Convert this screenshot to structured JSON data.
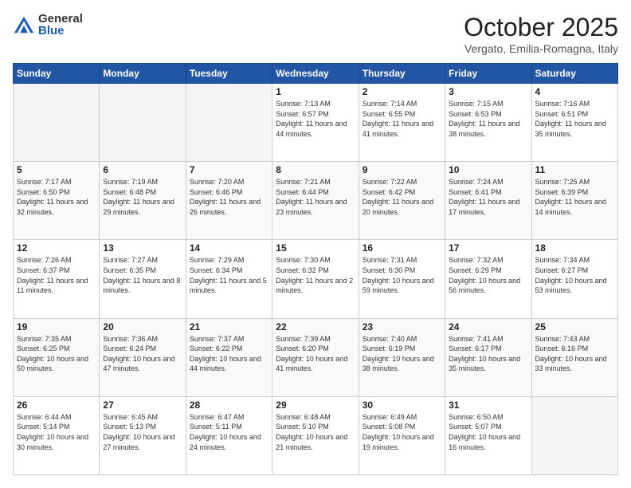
{
  "header": {
    "logo_general": "General",
    "logo_blue": "Blue",
    "month_title": "October 2025",
    "location": "Vergato, Emilia-Romagna, Italy"
  },
  "days_of_week": [
    "Sunday",
    "Monday",
    "Tuesday",
    "Wednesday",
    "Thursday",
    "Friday",
    "Saturday"
  ],
  "weeks": [
    [
      {
        "day": "",
        "info": ""
      },
      {
        "day": "",
        "info": ""
      },
      {
        "day": "",
        "info": ""
      },
      {
        "day": "1",
        "info": "Sunrise: 7:13 AM\nSunset: 6:57 PM\nDaylight: 11 hours and 44 minutes."
      },
      {
        "day": "2",
        "info": "Sunrise: 7:14 AM\nSunset: 6:55 PM\nDaylight: 11 hours and 41 minutes."
      },
      {
        "day": "3",
        "info": "Sunrise: 7:15 AM\nSunset: 6:53 PM\nDaylight: 11 hours and 38 minutes."
      },
      {
        "day": "4",
        "info": "Sunrise: 7:16 AM\nSunset: 6:51 PM\nDaylight: 11 hours and 35 minutes."
      }
    ],
    [
      {
        "day": "5",
        "info": "Sunrise: 7:17 AM\nSunset: 6:50 PM\nDaylight: 11 hours and 32 minutes."
      },
      {
        "day": "6",
        "info": "Sunrise: 7:19 AM\nSunset: 6:48 PM\nDaylight: 11 hours and 29 minutes."
      },
      {
        "day": "7",
        "info": "Sunrise: 7:20 AM\nSunset: 6:46 PM\nDaylight: 11 hours and 26 minutes."
      },
      {
        "day": "8",
        "info": "Sunrise: 7:21 AM\nSunset: 6:44 PM\nDaylight: 11 hours and 23 minutes."
      },
      {
        "day": "9",
        "info": "Sunrise: 7:22 AM\nSunset: 6:42 PM\nDaylight: 11 hours and 20 minutes."
      },
      {
        "day": "10",
        "info": "Sunrise: 7:24 AM\nSunset: 6:41 PM\nDaylight: 11 hours and 17 minutes."
      },
      {
        "day": "11",
        "info": "Sunrise: 7:25 AM\nSunset: 6:39 PM\nDaylight: 11 hours and 14 minutes."
      }
    ],
    [
      {
        "day": "12",
        "info": "Sunrise: 7:26 AM\nSunset: 6:37 PM\nDaylight: 11 hours and 11 minutes."
      },
      {
        "day": "13",
        "info": "Sunrise: 7:27 AM\nSunset: 6:35 PM\nDaylight: 11 hours and 8 minutes."
      },
      {
        "day": "14",
        "info": "Sunrise: 7:29 AM\nSunset: 6:34 PM\nDaylight: 11 hours and 5 minutes."
      },
      {
        "day": "15",
        "info": "Sunrise: 7:30 AM\nSunset: 6:32 PM\nDaylight: 11 hours and 2 minutes."
      },
      {
        "day": "16",
        "info": "Sunrise: 7:31 AM\nSunset: 6:30 PM\nDaylight: 10 hours and 59 minutes."
      },
      {
        "day": "17",
        "info": "Sunrise: 7:32 AM\nSunset: 6:29 PM\nDaylight: 10 hours and 56 minutes."
      },
      {
        "day": "18",
        "info": "Sunrise: 7:34 AM\nSunset: 6:27 PM\nDaylight: 10 hours and 53 minutes."
      }
    ],
    [
      {
        "day": "19",
        "info": "Sunrise: 7:35 AM\nSunset: 6:25 PM\nDaylight: 10 hours and 50 minutes."
      },
      {
        "day": "20",
        "info": "Sunrise: 7:36 AM\nSunset: 6:24 PM\nDaylight: 10 hours and 47 minutes."
      },
      {
        "day": "21",
        "info": "Sunrise: 7:37 AM\nSunset: 6:22 PM\nDaylight: 10 hours and 44 minutes."
      },
      {
        "day": "22",
        "info": "Sunrise: 7:39 AM\nSunset: 6:20 PM\nDaylight: 10 hours and 41 minutes."
      },
      {
        "day": "23",
        "info": "Sunrise: 7:40 AM\nSunset: 6:19 PM\nDaylight: 10 hours and 38 minutes."
      },
      {
        "day": "24",
        "info": "Sunrise: 7:41 AM\nSunset: 6:17 PM\nDaylight: 10 hours and 35 minutes."
      },
      {
        "day": "25",
        "info": "Sunrise: 7:43 AM\nSunset: 6:16 PM\nDaylight: 10 hours and 33 minutes."
      }
    ],
    [
      {
        "day": "26",
        "info": "Sunrise: 6:44 AM\nSunset: 5:14 PM\nDaylight: 10 hours and 30 minutes."
      },
      {
        "day": "27",
        "info": "Sunrise: 6:45 AM\nSunset: 5:13 PM\nDaylight: 10 hours and 27 minutes."
      },
      {
        "day": "28",
        "info": "Sunrise: 6:47 AM\nSunset: 5:11 PM\nDaylight: 10 hours and 24 minutes."
      },
      {
        "day": "29",
        "info": "Sunrise: 6:48 AM\nSunset: 5:10 PM\nDaylight: 10 hours and 21 minutes."
      },
      {
        "day": "30",
        "info": "Sunrise: 6:49 AM\nSunset: 5:08 PM\nDaylight: 10 hours and 19 minutes."
      },
      {
        "day": "31",
        "info": "Sunrise: 6:50 AM\nSunset: 5:07 PM\nDaylight: 10 hours and 16 minutes."
      },
      {
        "day": "",
        "info": ""
      }
    ]
  ]
}
